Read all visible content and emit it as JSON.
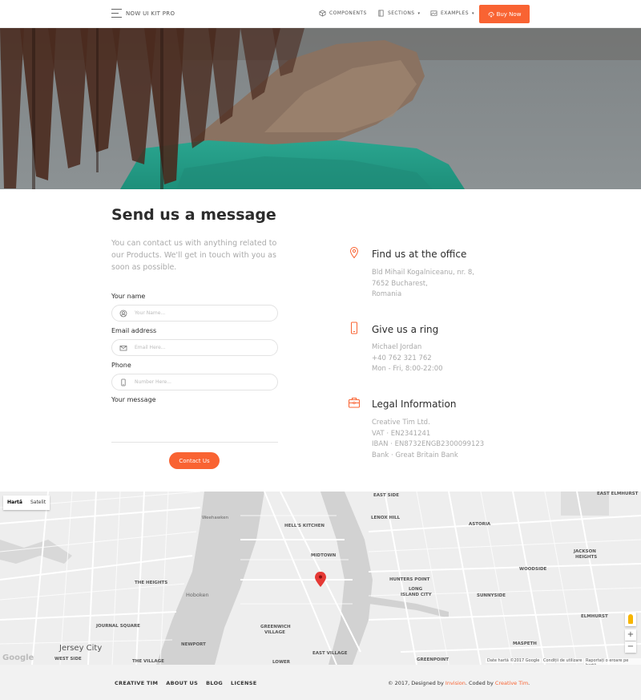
{
  "navbar": {
    "brand": "NOW UI KIT PRO",
    "items": [
      {
        "label": "COMPONENTS",
        "icon": "cube-icon"
      },
      {
        "label": "SECTIONS",
        "icon": "book-icon"
      },
      {
        "label": "EXAMPLES",
        "icon": "image-icon"
      }
    ],
    "buy_label": "Buy Now"
  },
  "content": {
    "title": "Send us a message",
    "lead": "You can contact us with anything related to our Products. We'll get in touch with you as soon as possible.",
    "form": {
      "name_label": "Your name",
      "name_placeholder": "Your Name...",
      "email_label": "Email address",
      "email_placeholder": "Email Here...",
      "phone_label": "Phone",
      "phone_placeholder": "Number Here...",
      "message_label": "Your message",
      "submit_label": "Contact Us"
    }
  },
  "info": [
    {
      "title": "Find us at the office",
      "lines": [
        "Bld Mihail Kogalniceanu, nr. 8,",
        "7652 Bucharest,",
        "Romania"
      ],
      "icon": "pin-icon"
    },
    {
      "title": "Give us a ring",
      "lines": [
        "Michael Jordan",
        "+40 762 321 762",
        "Mon - Fri, 8:00-22:00"
      ],
      "icon": "phone-icon"
    },
    {
      "title": "Legal Information",
      "lines": [
        "Creative Tim Ltd.",
        "VAT · EN2341241",
        "IBAN · EN8732ENGB2300099123",
        "Bank · Great Britain Bank"
      ],
      "icon": "briefcase-icon"
    }
  ],
  "map": {
    "type_map": "Hartă",
    "type_satellite": "Satelit",
    "google": "Google",
    "footer_data": "Date hartă ©2017 Google",
    "footer_terms": "Condiții de utilizare",
    "footer_report": "Raportați o eroare pe hartă",
    "zoom_in": "+",
    "zoom_out": "−",
    "labels": {
      "weehawken": "Weehawken",
      "hells_kitchen": "HELL'S KITCHEN",
      "midtown": "MIDTOWN",
      "the_heights": "THE HEIGHTS",
      "hoboken": "Hoboken",
      "journal_square": "JOURNAL SQUARE",
      "jersey_city": "Jersey City",
      "newport": "NEWPORT",
      "greenwich": "GREENWICH",
      "village": "VILLAGE",
      "east_village": "EAST VILLAGE",
      "the_village": "THE VILLAGE",
      "west_side": "WEST SIDE",
      "lower": "LOWER",
      "lenox_hill": "LENOX HILL",
      "east_side": "EAST SIDE",
      "astoria": "ASTORIA",
      "hunters_point": "HUNTERS POINT",
      "long_island_city": "LONG",
      "long_island_city2": "ISLAND CITY",
      "sunnyside": "SUNNYSIDE",
      "woodside": "WOODSIDE",
      "jackson": "JACKSON",
      "heights": "HEIGHTS",
      "elmhurst": "ELMHURST",
      "east_elmhurst": "EAST ELMHURST",
      "maspeth": "MASPETH",
      "greenpoint": "GREENPOINT"
    }
  },
  "footer": {
    "links": [
      "CREATIVE TIM",
      "ABOUT US",
      "BLOG",
      "LICENSE"
    ],
    "copyright_prefix": "© 2017, Designed by ",
    "designer": "Invision",
    "copyright_mid": ". Coded by ",
    "coder": "Creative Tim",
    "copyright_end": "."
  }
}
